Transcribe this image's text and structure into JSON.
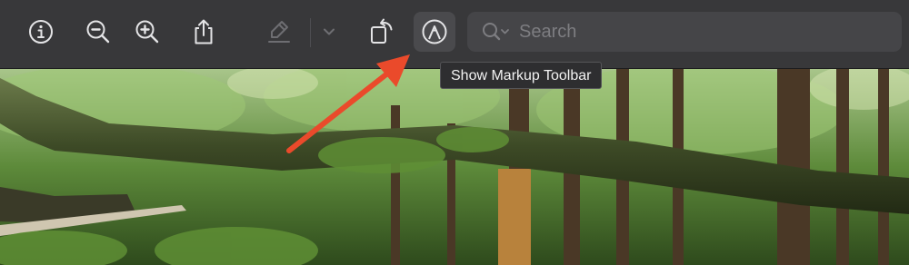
{
  "toolbar": {
    "buttons": [
      {
        "name": "info-icon"
      },
      {
        "name": "zoom-out-icon"
      },
      {
        "name": "zoom-in-icon"
      },
      {
        "name": "share-icon"
      },
      {
        "name": "highlight-pen-icon"
      },
      {
        "name": "chevron-down-icon"
      },
      {
        "name": "rotate-icon"
      },
      {
        "name": "markup-icon"
      }
    ],
    "search": {
      "placeholder": "Search"
    }
  },
  "tooltip": {
    "text": "Show Markup Toolbar"
  },
  "annotation": {
    "arrow_color": "#ea4a2b"
  },
  "colors": {
    "toolbar_bg": "#38383a",
    "icon": "#e4e4e6",
    "icon_disabled": "#6e6e72"
  }
}
